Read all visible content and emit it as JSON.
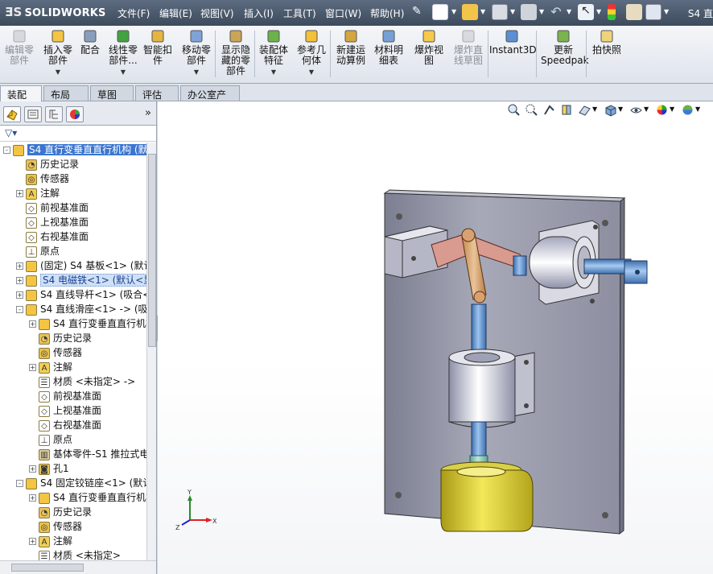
{
  "app": {
    "logo_text": "SOLIDWORKS",
    "title_tail": "S4 直"
  },
  "menu": [
    "文件(F)",
    "编辑(E)",
    "视图(V)",
    "插入(I)",
    "工具(T)",
    "窗口(W)",
    "帮助(H)"
  ],
  "commands": [
    {
      "label": "编辑零\n部件",
      "icon": "edit-component-icon",
      "disabled": true
    },
    {
      "label": "插入零\n部件",
      "icon": "insert-components-icon",
      "disabled": false,
      "dropdown": true
    },
    {
      "label": "配合",
      "icon": "mate-icon",
      "disabled": false
    },
    {
      "label": "线性零\n部件...",
      "icon": "linear-pattern-icon",
      "disabled": false,
      "dropdown": true
    },
    {
      "label": "智能扣\n件",
      "icon": "smart-fasteners-icon",
      "disabled": false
    },
    {
      "label": "移动零\n部件",
      "icon": "move-component-icon",
      "disabled": false,
      "dropdown": true
    },
    {
      "label": "显示隐\n藏的零\n部件",
      "icon": "show-hidden-icon",
      "disabled": false
    },
    {
      "label": "装配体\n特征",
      "icon": "assembly-features-icon",
      "disabled": false,
      "dropdown": true
    },
    {
      "label": "参考几\n何体",
      "icon": "reference-geometry-icon",
      "disabled": false,
      "dropdown": true
    },
    {
      "label": "新建运\n动算例",
      "icon": "new-motion-study-icon",
      "disabled": false
    },
    {
      "label": "材料明\n细表",
      "icon": "bom-icon",
      "disabled": false
    },
    {
      "label": "爆炸视\n图",
      "icon": "exploded-view-icon",
      "disabled": false
    },
    {
      "label": "爆炸直\n线草图",
      "icon": "explode-line-sketch-icon",
      "disabled": true
    },
    {
      "label": "Instant3D",
      "icon": "instant3d-icon",
      "disabled": false
    },
    {
      "label": "更新\nSpeedpak",
      "icon": "update-speedpak-icon",
      "disabled": false
    },
    {
      "label": "拍快照",
      "icon": "snapshot-icon",
      "disabled": false
    }
  ],
  "tabs": [
    {
      "label": "装配体",
      "active": true
    },
    {
      "label": "布局",
      "active": false
    },
    {
      "label": "草图",
      "active": false
    },
    {
      "label": "评估",
      "active": false
    },
    {
      "label": "办公室产品",
      "active": false
    }
  ],
  "tree": [
    {
      "level": 0,
      "exp": "-",
      "icon": "assembly-icon",
      "label": "S4 直行变垂直直行机构  (默认",
      "state": "selected"
    },
    {
      "level": 1,
      "exp": "",
      "icon": "history-icon",
      "label": "历史记录"
    },
    {
      "level": 1,
      "exp": "",
      "icon": "sensor-icon",
      "label": "传感器"
    },
    {
      "level": 1,
      "exp": "+",
      "icon": "annotation-icon",
      "label": "注解"
    },
    {
      "level": 1,
      "exp": "",
      "icon": "plane-icon",
      "label": "前视基准面"
    },
    {
      "level": 1,
      "exp": "",
      "icon": "plane-icon",
      "label": "上视基准面"
    },
    {
      "level": 1,
      "exp": "",
      "icon": "plane-icon",
      "label": "右视基准面"
    },
    {
      "level": 1,
      "exp": "",
      "icon": "origin-icon",
      "label": "原点"
    },
    {
      "level": 1,
      "exp": "+",
      "icon": "part-icon",
      "label": "(固定) S4 基板<1> (默认<"
    },
    {
      "level": 1,
      "exp": "+",
      "icon": "part-edit-icon",
      "label": "S4 电磁铁<1> (默认<显示",
      "state": "highlight"
    },
    {
      "level": 1,
      "exp": "+",
      "icon": "part-icon",
      "label": "S4 直线导杆<1> (吸合<<"
    },
    {
      "level": 1,
      "exp": "-",
      "icon": "part-icon",
      "label": "S4 直线滑座<1> -> (吸合"
    },
    {
      "level": 2,
      "exp": "+",
      "icon": "part-ref-icon",
      "label": "S4 直行变垂直直行机构"
    },
    {
      "level": 2,
      "exp": "",
      "icon": "history-icon",
      "label": "历史记录"
    },
    {
      "level": 2,
      "exp": "",
      "icon": "sensor-icon",
      "label": "传感器"
    },
    {
      "level": 2,
      "exp": "+",
      "icon": "annotation-icon",
      "label": "注解"
    },
    {
      "level": 2,
      "exp": "",
      "icon": "material-icon",
      "label": "材质 <未指定> ->"
    },
    {
      "level": 2,
      "exp": "",
      "icon": "plane-icon",
      "label": "前视基准面"
    },
    {
      "level": 2,
      "exp": "",
      "icon": "plane-icon",
      "label": "上视基准面"
    },
    {
      "level": 2,
      "exp": "",
      "icon": "plane-icon",
      "label": "右视基准面"
    },
    {
      "level": 2,
      "exp": "",
      "icon": "origin-icon",
      "label": "原点"
    },
    {
      "level": 2,
      "exp": "",
      "icon": "base-part-icon",
      "label": "基体零件-S1 推拉式电"
    },
    {
      "level": 2,
      "exp": "+",
      "icon": "hole-icon",
      "label": "孔1"
    },
    {
      "level": 1,
      "exp": "-",
      "icon": "part-icon",
      "label": "S4 固定铰链座<1> (默认-"
    },
    {
      "level": 2,
      "exp": "+",
      "icon": "part-ref-icon",
      "label": "S4 直行变垂直直行机构"
    },
    {
      "level": 2,
      "exp": "",
      "icon": "history-icon",
      "label": "历史记录"
    },
    {
      "level": 2,
      "exp": "",
      "icon": "sensor-icon",
      "label": "传感器"
    },
    {
      "level": 2,
      "exp": "+",
      "icon": "annotation-icon",
      "label": "注解"
    },
    {
      "level": 2,
      "exp": "",
      "icon": "material-icon",
      "label": "材质 <未指定>"
    }
  ],
  "triad": {
    "x": "X",
    "y": "Y",
    "z": "Z"
  }
}
